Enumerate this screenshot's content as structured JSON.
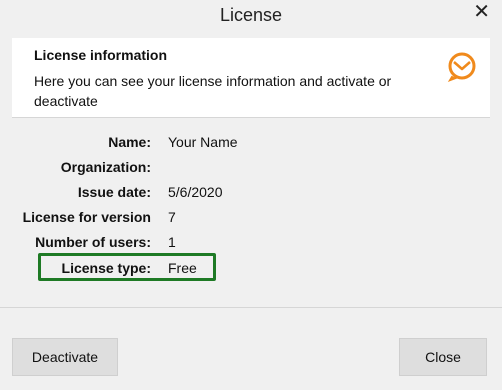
{
  "window": {
    "title": "License"
  },
  "header": {
    "title": "License information",
    "description": "Here you can see your license information and activate or deactivate",
    "accent_color": "#f08a1c"
  },
  "fields": [
    {
      "label": "Name:",
      "value": "Your Name"
    },
    {
      "label": "Organization:",
      "value": ""
    },
    {
      "label": "Issue date:",
      "value": "5/6/2020"
    },
    {
      "label": "License for version",
      "value": "7"
    },
    {
      "label": "Number of users:",
      "value": "1"
    },
    {
      "label": "License type:",
      "value": "Free"
    }
  ],
  "highlight_color": "#1e7a25",
  "buttons": {
    "deactivate": "Deactivate",
    "close": "Close"
  },
  "icons": {
    "close": "✕"
  }
}
